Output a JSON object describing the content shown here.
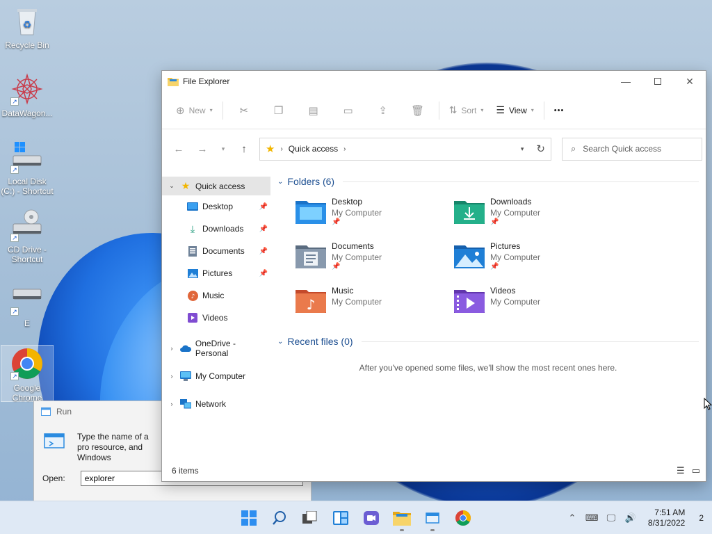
{
  "desktop": {
    "icons": [
      {
        "label": "Recycle Bin"
      },
      {
        "label": "DataWagon..."
      },
      {
        "label": "Local Disk (C:) - Shortcut"
      },
      {
        "label": "CD Drive - Shortcut"
      },
      {
        "label": "E"
      },
      {
        "label": "Google Chrome"
      }
    ]
  },
  "run_dialog": {
    "title": "Run",
    "description": "Type the name of a pro resource, and Windows",
    "open_label": "Open:",
    "open_value": "explorer"
  },
  "explorer": {
    "title": "File Explorer",
    "toolbar": {
      "new_label": "New",
      "sort_label": "Sort",
      "view_label": "View",
      "more_label": "•••"
    },
    "address": {
      "location": "Quick access"
    },
    "search": {
      "placeholder": "Search Quick access"
    },
    "sidebar": {
      "quick_access": "Quick access",
      "pinned": [
        {
          "label": "Desktop",
          "icon": "desktop-icon"
        },
        {
          "label": "Downloads",
          "icon": "downloads-icon"
        },
        {
          "label": "Documents",
          "icon": "documents-icon"
        },
        {
          "label": "Pictures",
          "icon": "pictures-icon"
        },
        {
          "label": "Music",
          "icon": "music-icon"
        },
        {
          "label": "Videos",
          "icon": "videos-icon"
        }
      ],
      "roots": [
        {
          "label": "OneDrive - Personal",
          "icon": "onedrive-icon"
        },
        {
          "label": "My Computer",
          "icon": "computer-icon"
        },
        {
          "label": "Network",
          "icon": "network-icon"
        }
      ]
    },
    "folders": {
      "heading": "Folders (6)",
      "items": [
        {
          "name": "Desktop",
          "location": "My Computer",
          "pinned": true,
          "color": "#1a73c8"
        },
        {
          "name": "Downloads",
          "location": "My Computer",
          "pinned": true,
          "color": "#1f9a7a"
        },
        {
          "name": "Documents",
          "location": "My Computer",
          "pinned": true,
          "color": "#6f8298"
        },
        {
          "name": "Pictures",
          "location": "My Computer",
          "pinned": true,
          "color": "#1f7fd6"
        },
        {
          "name": "Music",
          "location": "My Computer",
          "pinned": false,
          "color": "#e0663a"
        },
        {
          "name": "Videos",
          "location": "My Computer",
          "pinned": false,
          "color": "#7f4cd1"
        }
      ]
    },
    "recent": {
      "heading": "Recent files (0)",
      "empty_message": "After you've opened some files, we'll show the most recent ones here."
    },
    "status": {
      "count": "6 items"
    }
  },
  "taskbar": {
    "clock_time": "7:51 AM",
    "clock_date": "8/31/2022",
    "notification_count": "2"
  },
  "colors": {
    "accent": "#0067c0",
    "folder_yellow": "#f2c244",
    "taskbar": "#dfe9f5"
  }
}
